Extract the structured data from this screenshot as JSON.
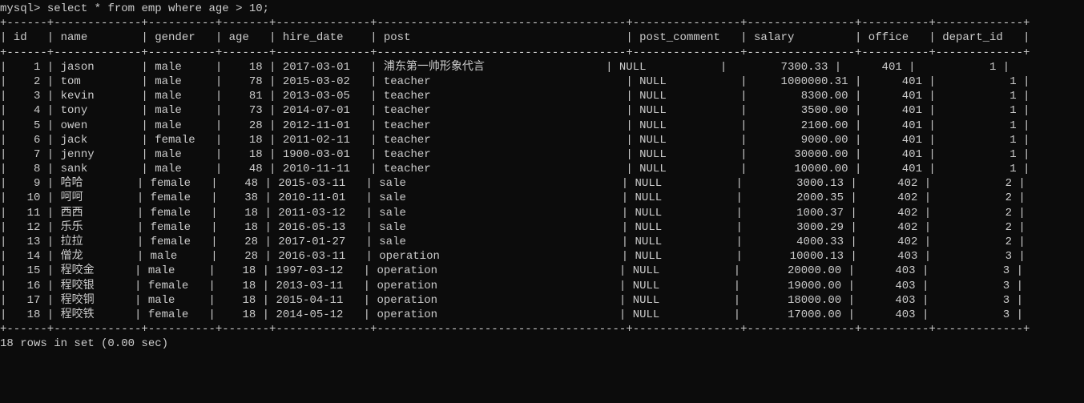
{
  "prompt": "mysql>",
  "query": "select * from emp where age > 10;",
  "columns": [
    "id",
    "name",
    "gender",
    "age",
    "hire_date",
    "post",
    "post_comment",
    "salary",
    "office",
    "depart_id"
  ],
  "rows": [
    {
      "id": 1,
      "name": "jason",
      "gender": "male",
      "age": 18,
      "hire_date": "2017-03-01",
      "post": "浦东第一帅形象代言",
      "post_comment": "NULL",
      "salary": "7300.33",
      "office": 401,
      "depart_id": 1
    },
    {
      "id": 2,
      "name": "tom",
      "gender": "male",
      "age": 78,
      "hire_date": "2015-03-02",
      "post": "teacher",
      "post_comment": "NULL",
      "salary": "1000000.31",
      "office": 401,
      "depart_id": 1
    },
    {
      "id": 3,
      "name": "kevin",
      "gender": "male",
      "age": 81,
      "hire_date": "2013-03-05",
      "post": "teacher",
      "post_comment": "NULL",
      "salary": "8300.00",
      "office": 401,
      "depart_id": 1
    },
    {
      "id": 4,
      "name": "tony",
      "gender": "male",
      "age": 73,
      "hire_date": "2014-07-01",
      "post": "teacher",
      "post_comment": "NULL",
      "salary": "3500.00",
      "office": 401,
      "depart_id": 1
    },
    {
      "id": 5,
      "name": "owen",
      "gender": "male",
      "age": 28,
      "hire_date": "2012-11-01",
      "post": "teacher",
      "post_comment": "NULL",
      "salary": "2100.00",
      "office": 401,
      "depart_id": 1
    },
    {
      "id": 6,
      "name": "jack",
      "gender": "female",
      "age": 18,
      "hire_date": "2011-02-11",
      "post": "teacher",
      "post_comment": "NULL",
      "salary": "9000.00",
      "office": 401,
      "depart_id": 1
    },
    {
      "id": 7,
      "name": "jenny",
      "gender": "male",
      "age": 18,
      "hire_date": "1900-03-01",
      "post": "teacher",
      "post_comment": "NULL",
      "salary": "30000.00",
      "office": 401,
      "depart_id": 1
    },
    {
      "id": 8,
      "name": "sank",
      "gender": "male",
      "age": 48,
      "hire_date": "2010-11-11",
      "post": "teacher",
      "post_comment": "NULL",
      "salary": "10000.00",
      "office": 401,
      "depart_id": 1
    },
    {
      "id": 9,
      "name": "哈哈",
      "gender": "female",
      "age": 48,
      "hire_date": "2015-03-11",
      "post": "sale",
      "post_comment": "NULL",
      "salary": "3000.13",
      "office": 402,
      "depart_id": 2
    },
    {
      "id": 10,
      "name": "呵呵",
      "gender": "female",
      "age": 38,
      "hire_date": "2010-11-01",
      "post": "sale",
      "post_comment": "NULL",
      "salary": "2000.35",
      "office": 402,
      "depart_id": 2
    },
    {
      "id": 11,
      "name": "西西",
      "gender": "female",
      "age": 18,
      "hire_date": "2011-03-12",
      "post": "sale",
      "post_comment": "NULL",
      "salary": "1000.37",
      "office": 402,
      "depart_id": 2
    },
    {
      "id": 12,
      "name": "乐乐",
      "gender": "female",
      "age": 18,
      "hire_date": "2016-05-13",
      "post": "sale",
      "post_comment": "NULL",
      "salary": "3000.29",
      "office": 402,
      "depart_id": 2
    },
    {
      "id": 13,
      "name": "拉拉",
      "gender": "female",
      "age": 28,
      "hire_date": "2017-01-27",
      "post": "sale",
      "post_comment": "NULL",
      "salary": "4000.33",
      "office": 402,
      "depart_id": 2
    },
    {
      "id": 14,
      "name": "僧龙",
      "gender": "male",
      "age": 28,
      "hire_date": "2016-03-11",
      "post": "operation",
      "post_comment": "NULL",
      "salary": "10000.13",
      "office": 403,
      "depart_id": 3
    },
    {
      "id": 15,
      "name": "程咬金",
      "gender": "male",
      "age": 18,
      "hire_date": "1997-03-12",
      "post": "operation",
      "post_comment": "NULL",
      "salary": "20000.00",
      "office": 403,
      "depart_id": 3
    },
    {
      "id": 16,
      "name": "程咬银",
      "gender": "female",
      "age": 18,
      "hire_date": "2013-03-11",
      "post": "operation",
      "post_comment": "NULL",
      "salary": "19000.00",
      "office": 403,
      "depart_id": 3
    },
    {
      "id": 17,
      "name": "程咬铜",
      "gender": "male",
      "age": 18,
      "hire_date": "2015-04-11",
      "post": "operation",
      "post_comment": "NULL",
      "salary": "18000.00",
      "office": 403,
      "depart_id": 3
    },
    {
      "id": 18,
      "name": "程咬铁",
      "gender": "female",
      "age": 18,
      "hire_date": "2014-05-12",
      "post": "operation",
      "post_comment": "NULL",
      "salary": "17000.00",
      "office": 403,
      "depart_id": 3
    }
  ],
  "status": "18 rows in set (0.00 sec)",
  "widths": {
    "id": 4,
    "name": 11,
    "gender": 8,
    "age": 5,
    "hire_date": 12,
    "post": 35,
    "post_comment": 14,
    "salary": 14,
    "office": 8,
    "depart_id": 11
  },
  "align": {
    "id": "right",
    "name": "left",
    "gender": "left",
    "age": "right",
    "hire_date": "left",
    "post": "left",
    "post_comment": "left",
    "salary": "right",
    "office": "right",
    "depart_id": "right"
  }
}
